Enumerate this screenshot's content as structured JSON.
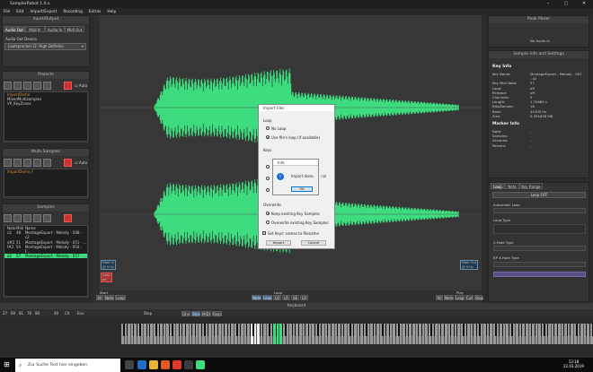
{
  "window": {
    "title": "SamplerRobot 1.0.x",
    "controls": [
      "–",
      "▢",
      "✕"
    ]
  },
  "menu": [
    "File",
    "Edit",
    "Import/Export",
    "Recording",
    "Extras",
    "Help"
  ],
  "left": {
    "io": {
      "title": "Input/Output",
      "tabs": [
        "Audio Out",
        "Midi In",
        "Audio In",
        "Midi Out"
      ],
      "device_label": "Audio Out Device",
      "device_value": "Lautsprecher (2- High Definitio"
    },
    "projects": {
      "title": "Projects",
      "auto": "Auto",
      "items": [
        "ImportDemo",
        "MixedMultisamples",
        "VP_KeyZones"
      ]
    },
    "multisamples": {
      "title": "Multi Samples",
      "auto": "Auto",
      "items": [
        "ImportDemo_F"
      ]
    },
    "samples": {
      "title": "Samples",
      "columns": [
        "Note",
        "Midi",
        "Name"
      ],
      "rows": [
        [
          "c2",
          "48",
          "MontageExport - Melody - 048 - c2"
        ],
        [
          "d#2",
          "51",
          "MontageExport - Melody - 051 - ..."
        ],
        [
          "f#2",
          "54",
          "MontageExport - Melody - 054 - F..."
        ],
        [
          "a2",
          "57",
          "MontageExport - Melody - 057 - ..."
        ]
      ]
    }
  },
  "center": {
    "marker_left": "Note In\n@ 0 Hz",
    "marker_left2": "Loop\noff",
    "marker_right": "Note Out\n@ 0 Hz",
    "bottom_left_label": "Start",
    "bottom_mid_label": "Loop",
    "bottom_right_label": "Play",
    "bl_buttons": [
      "All",
      "Note",
      "Loop"
    ],
    "bm_buttons": [
      "Note",
      "Loop",
      "LO",
      "LR",
      "SE",
      "LO"
    ],
    "br_buttons": [
      "All",
      "Note",
      "Loop",
      "Cut",
      "Stop"
    ]
  },
  "import_dialog": {
    "title": "Import Files",
    "loop_label": "Loop",
    "loop_opts": [
      "No Loop",
      "Use file's loop (if available)"
    ],
    "keys_label": "Keys",
    "overwrite_label": "Overwrite",
    "overwrite_opts": [
      "Keep existing Key Samples",
      "Overwrite existing Key Samples"
    ],
    "set_keys": "Set Keys' names to filename",
    "import_btn": "Import",
    "cancel_btn": "Cancel"
  },
  "info_dialog": {
    "title": "Info",
    "message": "Import done.",
    "ok": "OK",
    "side_text": "rial"
  },
  "right": {
    "peak_title": "Peak Meter",
    "no_audio": "No Audio In",
    "info_title": "Sample Info and Settings",
    "key_info": "Key Info",
    "rows": [
      [
        "Key Name:",
        "MontageExport - Melody - 057"
      ],
      [
        "",
        "- a2"
      ],
      [
        "Key Midi Note:",
        "57"
      ],
      [
        "Loop:",
        "off"
      ],
      [
        "Release:",
        "off"
      ],
      [
        "Channels:",
        "2"
      ],
      [
        "Length:",
        "1.70869 s"
      ],
      [
        "Bits/Sample:",
        "16"
      ],
      [
        "Rate:",
        "44100 Hz"
      ],
      [
        "Size:",
        "0.301838 MB"
      ]
    ],
    "marker_info": "Marker Info",
    "marker_rows": [
      [
        "Note:",
        "-"
      ],
      [
        "Samples:",
        "-"
      ],
      [
        "Seconds:",
        "-"
      ],
      [
        "Percent:",
        "-"
      ]
    ],
    "tabs": [
      "Loop",
      "Note",
      "Key Range"
    ],
    "loop_state": "Loop OFF",
    "auto_loop": "Automatic Loop",
    "loop_type": "Loop Type",
    "x_fade": "X-Fade Type",
    "bp_fade": "BP X-Fade Type"
  },
  "keyboard_title": "Keyboard",
  "toolbar": [
    "27",
    "69",
    "81",
    "76",
    "80",
    "49",
    "Ctl",
    "Env",
    "Step",
    "Ons",
    "Stps",
    "MIDI",
    "Reac"
  ],
  "taskbar": {
    "search": "Zur Suche Text hier eingeben",
    "time": "13:18",
    "date": "22.03.2019"
  },
  "colors": {
    "wave": "#3ddc7e",
    "accent": "#d98c3a",
    "bg": "#2b2b2b"
  }
}
